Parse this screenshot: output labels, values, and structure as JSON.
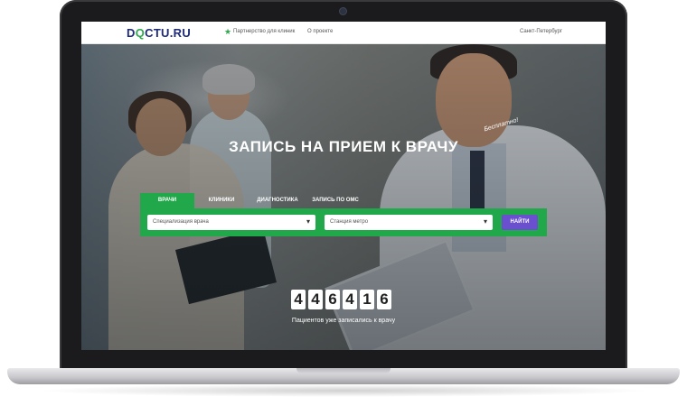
{
  "header": {
    "logo_prefix": "D",
    "logo_q": "Q",
    "logo_suffix": "CTU.RU",
    "partner_link": "Партнерство для клиник",
    "about_link": "О проекте",
    "city": "Санкт-Петербург"
  },
  "hero": {
    "title": "ЗАПИСЬ НА ПРИЕМ К ВРАЧУ",
    "free_badge": "Бесплатно!"
  },
  "tabs": [
    {
      "label": "ВРАЧИ",
      "active": true
    },
    {
      "label": "КЛИНИКИ",
      "active": false
    },
    {
      "label": "ДИАГНОСТИКА",
      "active": false
    },
    {
      "label": "ЗАПИСЬ ПО ОМС",
      "active": false
    }
  ],
  "search": {
    "specialization_placeholder": "Специализация врача",
    "metro_placeholder": "Станция метро",
    "find_button": "НАЙТИ"
  },
  "counter": {
    "digits": [
      "4",
      "4",
      "6",
      "4",
      "1",
      "6"
    ],
    "caption": "Пациентов уже записались к врачу"
  },
  "icons": {
    "star": "star-icon",
    "caret": "chevron-down-icon"
  },
  "colors": {
    "accent_green": "#20a84a",
    "button_purple": "#6a4fcf",
    "logo_blue": "#1e2a78"
  }
}
